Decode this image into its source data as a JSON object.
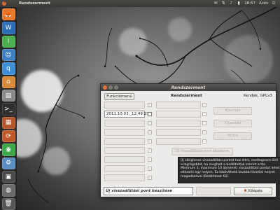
{
  "top_panel": {
    "title": "Rendszerment",
    "clock": "18:57",
    "user": "Acés"
  },
  "launcher": {
    "items": [
      {
        "name": "firefox",
        "label": "🦊",
        "color": "#e8792b"
      },
      {
        "name": "libreoffice-writer",
        "label": "W",
        "color": "#2c6fb5"
      },
      {
        "name": "ubuntu-software",
        "label": "i",
        "color": "#4caf50"
      },
      {
        "name": "empathy",
        "label": "☺",
        "color": "#3f7fc1"
      },
      {
        "name": "qbittorrent",
        "label": "q",
        "color": "#3f8ed8"
      },
      {
        "name": "home-folder",
        "label": "⌂",
        "color": "#d98a3a"
      },
      {
        "name": "file-manager",
        "label": "▤",
        "color": "#8a8a8a"
      },
      {
        "name": "terminal",
        "label": ">_",
        "color": "#2f2f2f"
      },
      {
        "name": "package-manager",
        "label": "▦",
        "color": "#b5572c"
      },
      {
        "name": "update-manager",
        "label": "⟳",
        "color": "#c05a2a"
      },
      {
        "name": "rendszerment",
        "label": "◉",
        "color": "#3fa94a"
      },
      {
        "name": "settings",
        "label": "⚙",
        "color": "#5a8fc0"
      },
      {
        "name": "workspaces",
        "label": "▣",
        "color": "#4a4a4a"
      },
      {
        "name": "disk",
        "label": "◍",
        "color": "#6a6a6a"
      },
      {
        "name": "trash",
        "label": "🗑",
        "color": "#555555"
      }
    ]
  },
  "dialog": {
    "title": "Rendszerment",
    "heading": "Rendszerment",
    "features_button": "Funkciómenü",
    "version": "Kendek, GPLv3",
    "restore_point_1": "2011.10.03._12:49:23",
    "side_buttons": [
      "Kivonás",
      "Kijavítás",
      "Törlés"
    ],
    "create_point_button": "Új visszaállítási pont készítése",
    "tooltip": "Új ideiglenes visszaállítási pontot hoz létre, esetlegesen törli a legrégebbit, ha meghalt a beállítottak szerint a tár. Minimum 3, maximum 10 átmeneti visszaállítási pontot lehet eltárolni egy helyen. Ez kibővíthető további tárolási helyek megadásával (Beállítások fül).",
    "new_point_input": "Új visszaállítási pont készítése",
    "exit_button": "Kilépés"
  },
  "colors": {
    "accent": "#e3713a",
    "titlebar": "#4a4844",
    "dialog_bg": "#edebe9"
  }
}
